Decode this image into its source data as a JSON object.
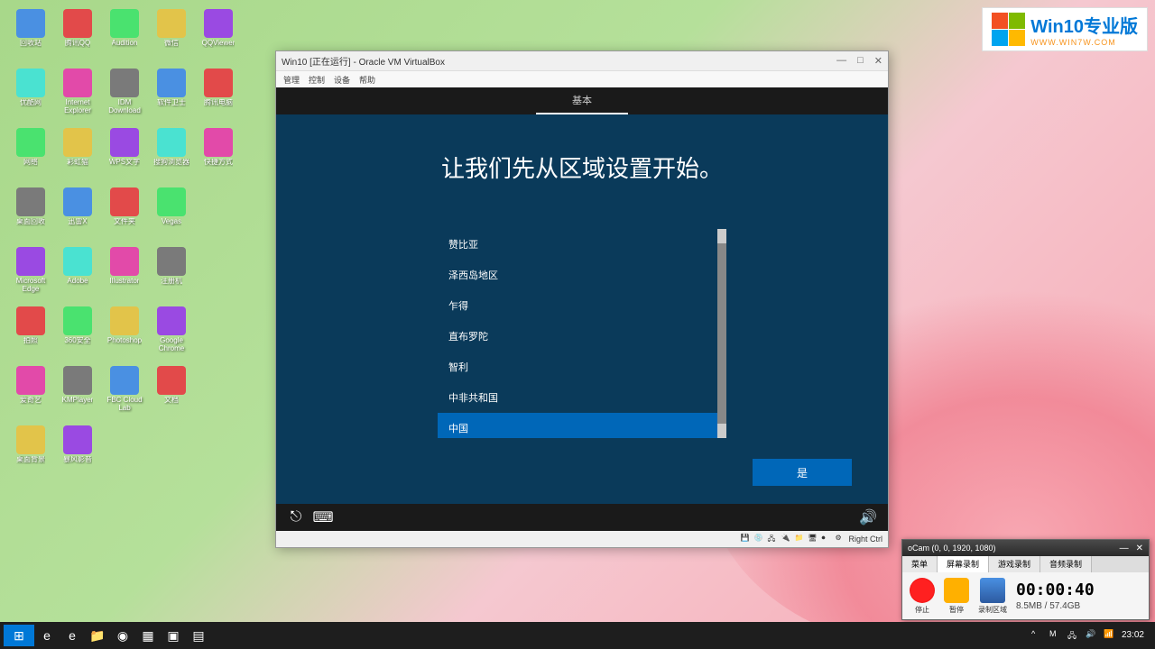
{
  "desktop_icons": [
    {
      "label": "回收站"
    },
    {
      "label": "腾讯QQ"
    },
    {
      "label": "Audition"
    },
    {
      "label": "微信"
    },
    {
      "label": "QQViewer"
    },
    {
      "label": "优酷网"
    },
    {
      "label": "Internet Explorer"
    },
    {
      "label": "IDM Download"
    },
    {
      "label": "软件卫士"
    },
    {
      "label": "腾讯电脑"
    },
    {
      "label": "网络"
    },
    {
      "label": "彩虹猫"
    },
    {
      "label": "WPS文字"
    },
    {
      "label": "搜狗浏览器"
    },
    {
      "label": "快捷方式"
    },
    {
      "label": "桌面回收"
    },
    {
      "label": "迅雷X"
    },
    {
      "label": "文件夹"
    },
    {
      "label": "Vegas"
    },
    {
      "label": ""
    },
    {
      "label": "Microsoft Edge"
    },
    {
      "label": "Adobe"
    },
    {
      "label": "Illustrator"
    },
    {
      "label": "注册机"
    },
    {
      "label": ""
    },
    {
      "label": "拍照"
    },
    {
      "label": "360安全"
    },
    {
      "label": "Photoshop"
    },
    {
      "label": "Google Chrome"
    },
    {
      "label": ""
    },
    {
      "label": "爱奇艺"
    },
    {
      "label": "KMPlayer"
    },
    {
      "label": "FBC Cloud Lab"
    },
    {
      "label": "文档"
    },
    {
      "label": ""
    },
    {
      "label": "桌面背景"
    },
    {
      "label": "暴风影音"
    },
    {
      "label": ""
    },
    {
      "label": ""
    },
    {
      "label": ""
    }
  ],
  "vbox": {
    "title": "Win10 [正在运行] - Oracle VM VirtualBox",
    "menu": [
      "管理",
      "控制",
      "设备",
      "帮助"
    ],
    "win_controls": {
      "min": "—",
      "max": "□",
      "close": "✕"
    },
    "host_key": "Right Ctrl"
  },
  "oobe": {
    "top_tab": "基本",
    "heading": "让我们先从区域设置开始。",
    "regions": [
      {
        "name": "赞比亚",
        "selected": false
      },
      {
        "name": "泽西岛地区",
        "selected": false
      },
      {
        "name": "乍得",
        "selected": false
      },
      {
        "name": "直布罗陀",
        "selected": false
      },
      {
        "name": "智利",
        "selected": false
      },
      {
        "name": "中非共和国",
        "selected": false
      },
      {
        "name": "中国",
        "selected": true
      }
    ],
    "yes_button": "是"
  },
  "ocam": {
    "title": "oCam (0, 0, 1920, 1080)",
    "controls": {
      "min": "—",
      "close": "✕"
    },
    "tabs": [
      "菜单",
      "屏幕录制",
      "游戏录制",
      "音频录制"
    ],
    "active_tab": 1,
    "buttons": {
      "record": "停止",
      "pause": "暂停",
      "target": "录制区域"
    },
    "time": "00:00:40",
    "size": "8.5MB / 57.4GB"
  },
  "watermark": {
    "title": "Win10专业版",
    "url": "WWW.WIN7W.COM"
  },
  "taskbar": {
    "time": "23:02"
  }
}
